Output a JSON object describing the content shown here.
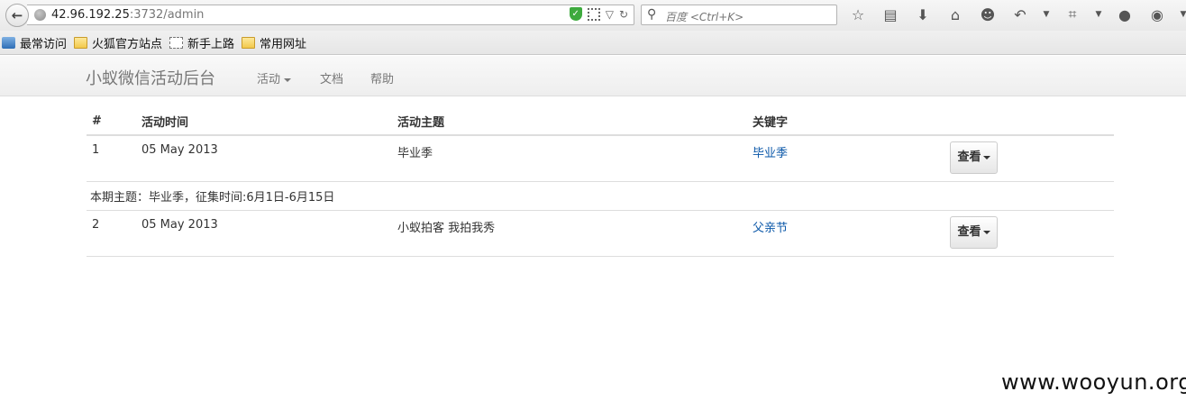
{
  "browser": {
    "url_host": "42.96.192.25",
    "url_path": ":3732/admin",
    "search_placeholder": "百度 <Ctrl+K>"
  },
  "bookmarks": [
    {
      "label": "最常访问",
      "icon": "most-visited-icon"
    },
    {
      "label": "火狐官方站点",
      "icon": "folder-icon"
    },
    {
      "label": "新手上路",
      "icon": "page-icon"
    },
    {
      "label": "常用网址",
      "icon": "folder-icon"
    }
  ],
  "nav": {
    "brand": "小蚁微信活动后台",
    "items": [
      {
        "label": "活动",
        "dropdown": true
      },
      {
        "label": "文档"
      },
      {
        "label": "帮助"
      }
    ]
  },
  "table": {
    "headers": [
      "#",
      "活动时间",
      "活动主题",
      "关键字",
      ""
    ],
    "rows": [
      {
        "num": "1",
        "date": "05 May 2013",
        "topic": "毕业季",
        "keyword": "毕业季",
        "action": "查看",
        "note": "本期主题：毕业季，征集时间:6月1日-6月15日"
      },
      {
        "num": "2",
        "date": "05 May 2013",
        "topic": "小蚁拍客 我拍我秀",
        "keyword": "父亲节",
        "action": "查看",
        "note": ""
      }
    ]
  },
  "watermark": "www.wooyun.org",
  "colors": {
    "link": "#0a57a8",
    "brand": "#777777"
  }
}
